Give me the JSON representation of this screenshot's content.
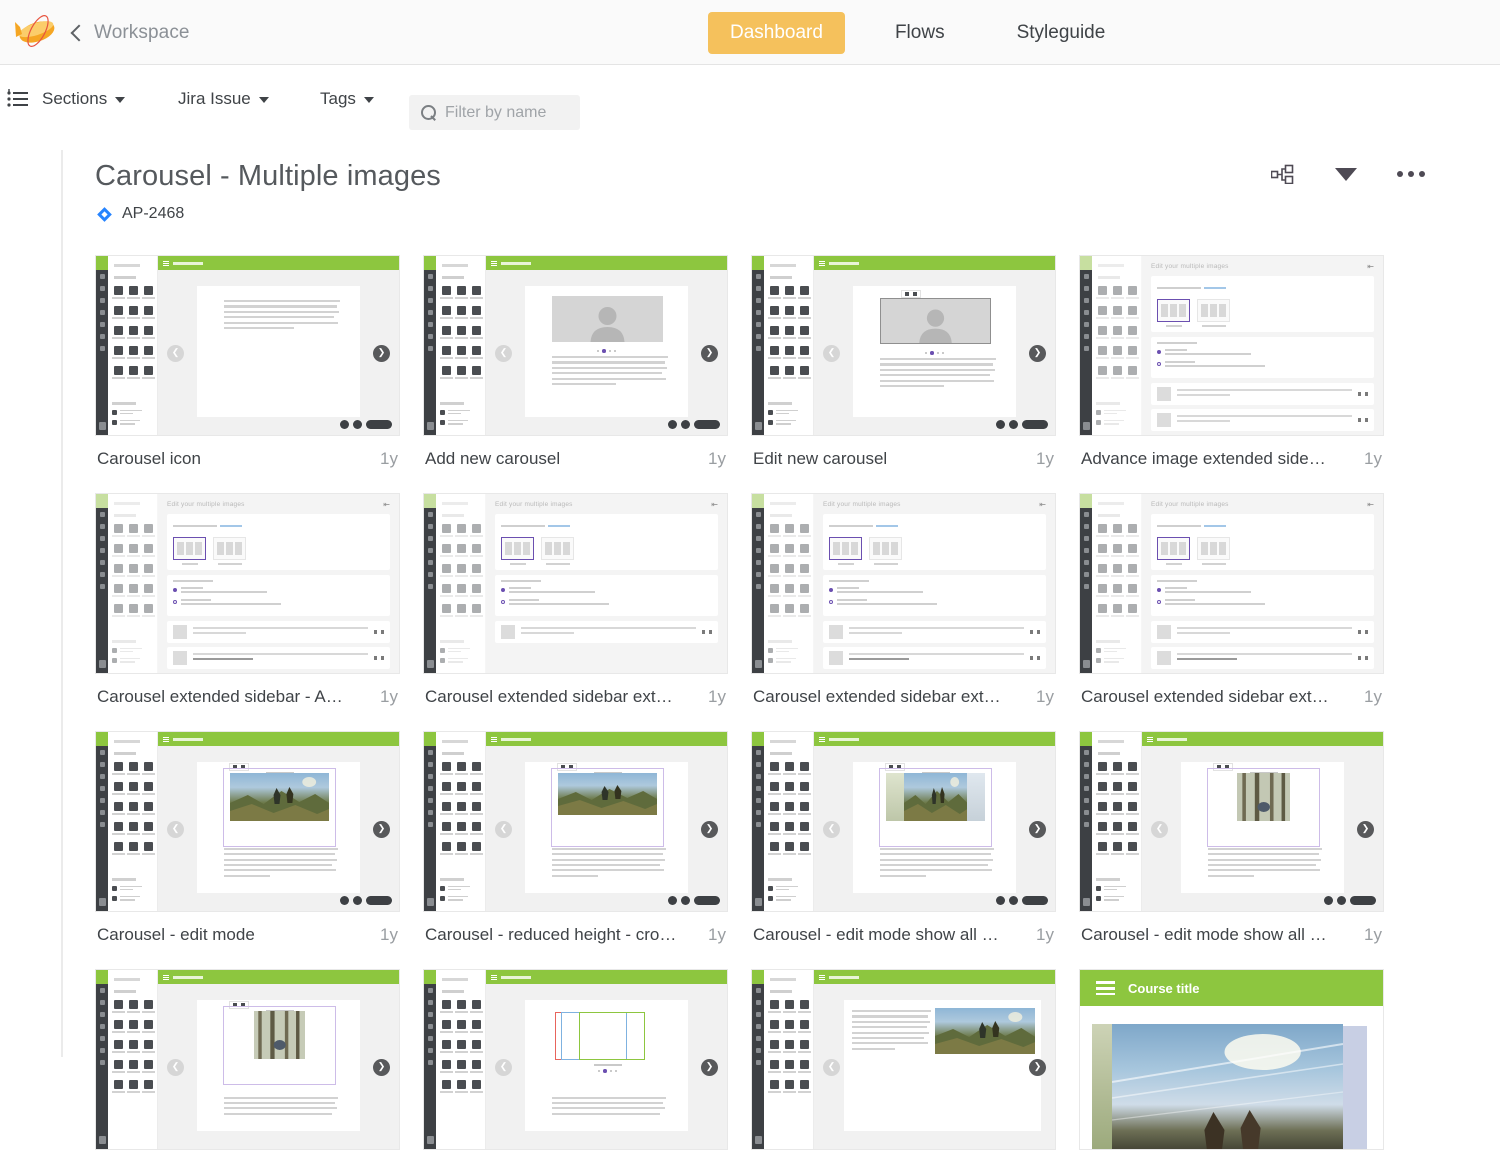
{
  "topbar": {
    "logo_icon": "blimp-logo-icon",
    "back_icon": "chevron-left-icon",
    "back_label": "Workspace",
    "tabs": [
      {
        "label": "Dashboard",
        "active": true
      },
      {
        "label": "Flows",
        "active": false
      },
      {
        "label": "Styleguide",
        "active": false
      }
    ]
  },
  "filterbar": {
    "sections_icon": "sections-list-icon",
    "filters": [
      {
        "label": "Sections"
      },
      {
        "label": "Jira Issue"
      },
      {
        "label": "Tags"
      }
    ],
    "search": {
      "icon": "search-icon",
      "placeholder": "Filter by name",
      "value": ""
    }
  },
  "page": {
    "title": "Carousel - Multiple images",
    "jira_icon": "jira-issue-icon",
    "jira_key": "AP-2468",
    "actions": [
      {
        "name": "flow-view-icon"
      },
      {
        "name": "sort-caret-icon"
      },
      {
        "name": "more-options-icon"
      }
    ]
  },
  "grid": {
    "cards": [
      {
        "name": "Carousel icon",
        "age": "1y",
        "variant": "editor-text"
      },
      {
        "name": "Add new carousel",
        "age": "1y",
        "variant": "editor-avatar"
      },
      {
        "name": "Edit new carousel",
        "age": "1y",
        "variant": "editor-avatar-selected"
      },
      {
        "name": "Advance image extended sideb…",
        "age": "1y",
        "variant": "settings-panel"
      },
      {
        "name": "Carousel extended sidebar - Ad…",
        "age": "1y",
        "variant": "settings-panel"
      },
      {
        "name": "Carousel extended sidebar ext…",
        "age": "1y",
        "variant": "settings-panel"
      },
      {
        "name": "Carousel extended sidebar ext…",
        "age": "1y",
        "variant": "settings-panel"
      },
      {
        "name": "Carousel extended sidebar ext…",
        "age": "1y",
        "variant": "settings-panel"
      },
      {
        "name": "Carousel - edit mode",
        "age": "1y",
        "variant": "editor-photo"
      },
      {
        "name": "Carousel - reduced height - cro…",
        "age": "1y",
        "variant": "editor-photo-short"
      },
      {
        "name": "Carousel - edit mode show all s…",
        "age": "1y",
        "variant": "editor-photo-wide"
      },
      {
        "name": "Carousel - edit mode show all s…",
        "age": "1y",
        "variant": "editor-photo-narrow"
      },
      {
        "name": "",
        "age": "",
        "variant": "editor-photo-portrait"
      },
      {
        "name": "",
        "age": "",
        "variant": "editor-outlines"
      },
      {
        "name": "",
        "age": "",
        "variant": "editor-photo-wide"
      },
      {
        "name": "",
        "age": "",
        "variant": "preview",
        "preview_title": "Course title"
      }
    ]
  },
  "colors": {
    "accent_yellow": "#f5c15c",
    "brand_green": "#8dc63f",
    "jira_blue": "#2684ff",
    "rail_dark": "#3d4044",
    "select_purple": "#6b4fb0"
  }
}
